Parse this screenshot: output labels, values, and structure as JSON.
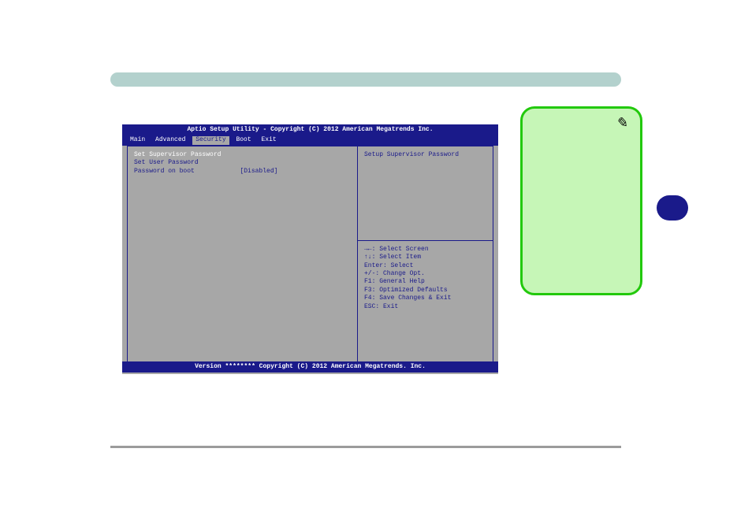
{
  "bios": {
    "header": "Aptio Setup Utility - Copyright (C) 2012 American Megatrends Inc.",
    "tabs": [
      "Main",
      "Advanced",
      "Security",
      "Boot",
      "Exit"
    ],
    "active_tab": 2,
    "left_panel": {
      "line1": "Set Supervisor Password",
      "line2": "Set User Password",
      "line3_label": "Password on boot",
      "line3_value": "[Disabled]"
    },
    "right_top": "Setup Supervisor Password",
    "help": {
      "l1": "→←: Select Screen",
      "l2": "↑↓: Select Item",
      "l3": "Enter: Select",
      "l4": "+/-: Change Opt.",
      "l5": "F1: General Help",
      "l6": "F3: Optimized Defaults",
      "l7": "F4: Save Changes & Exit",
      "l8": "ESC: Exit"
    },
    "footer": "Version ******** Copyright (C) 2012 American Megatrends. Inc."
  },
  "note_icon": "✎"
}
